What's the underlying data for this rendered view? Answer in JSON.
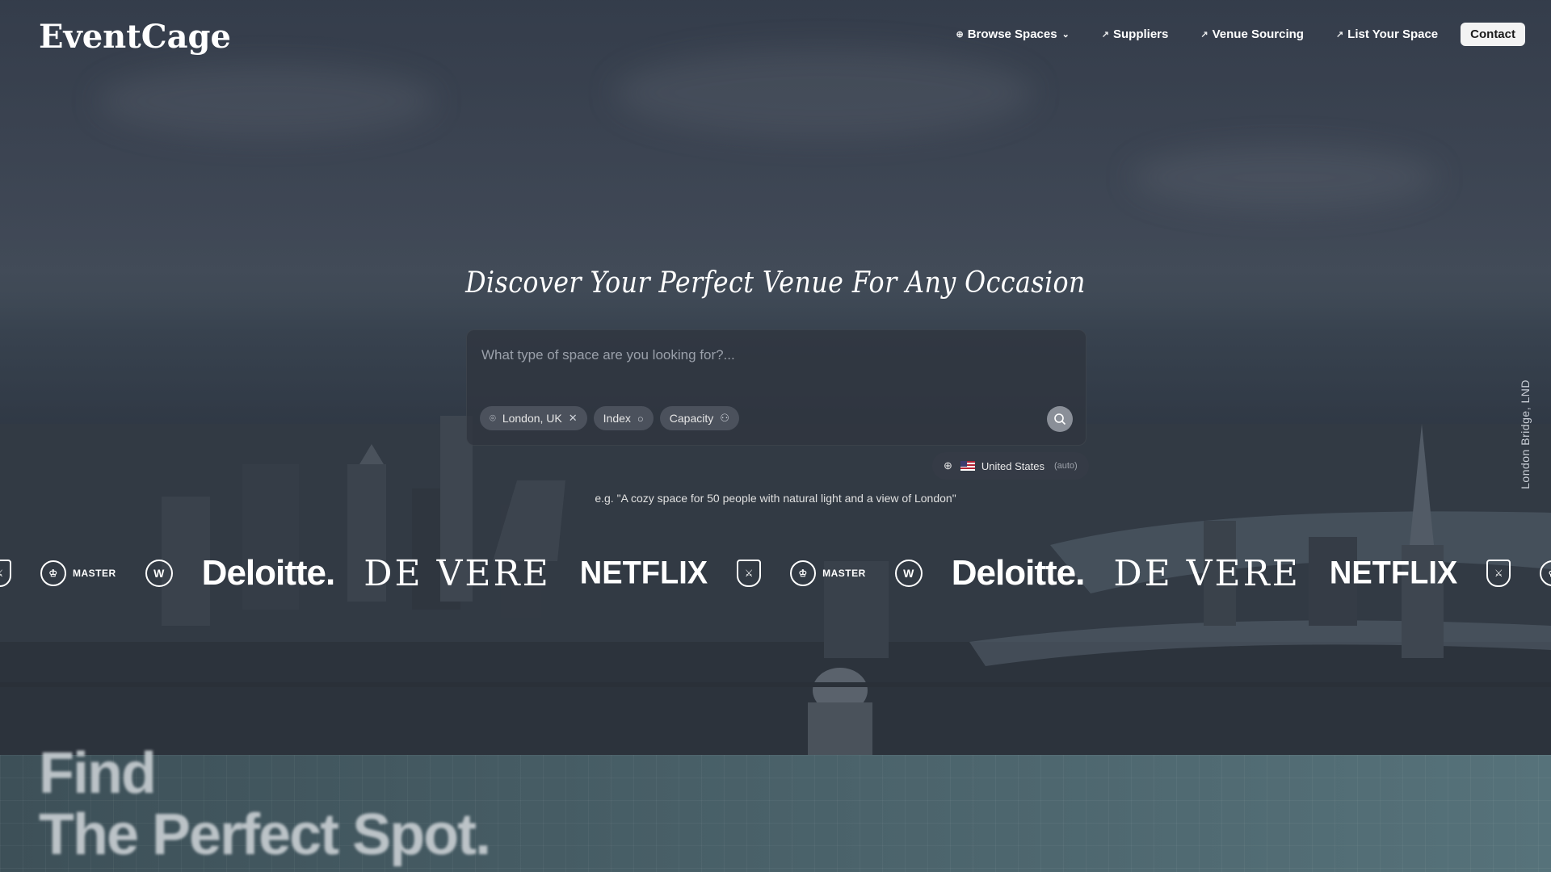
{
  "brand": {
    "logo": "EventCage"
  },
  "nav": {
    "browse": "Browse Spaces",
    "suppliers": "Suppliers",
    "venue_sourcing": "Venue Sourcing",
    "list_space": "List Your Space",
    "contact": "Contact"
  },
  "hero": {
    "headline": "Discover Your Perfect Venue For Any Occasion",
    "search_placeholder": "What type of space are you looking for?...",
    "chips": {
      "location": "London, UK",
      "index": "Index",
      "capacity": "Capacity"
    },
    "region": {
      "country": "United States",
      "mode": "(auto)"
    },
    "example": "e.g. \"A cozy space for 50 people with natural light and a view of London\"",
    "photo_credit": "London Bridge, LND"
  },
  "logos": {
    "master": "MASTER",
    "deloitte": "Deloitte.",
    "devere": "DE VERE",
    "netflix": "NETFLIX"
  },
  "section": {
    "line1": "Find",
    "line2": "The Perfect Spot."
  }
}
